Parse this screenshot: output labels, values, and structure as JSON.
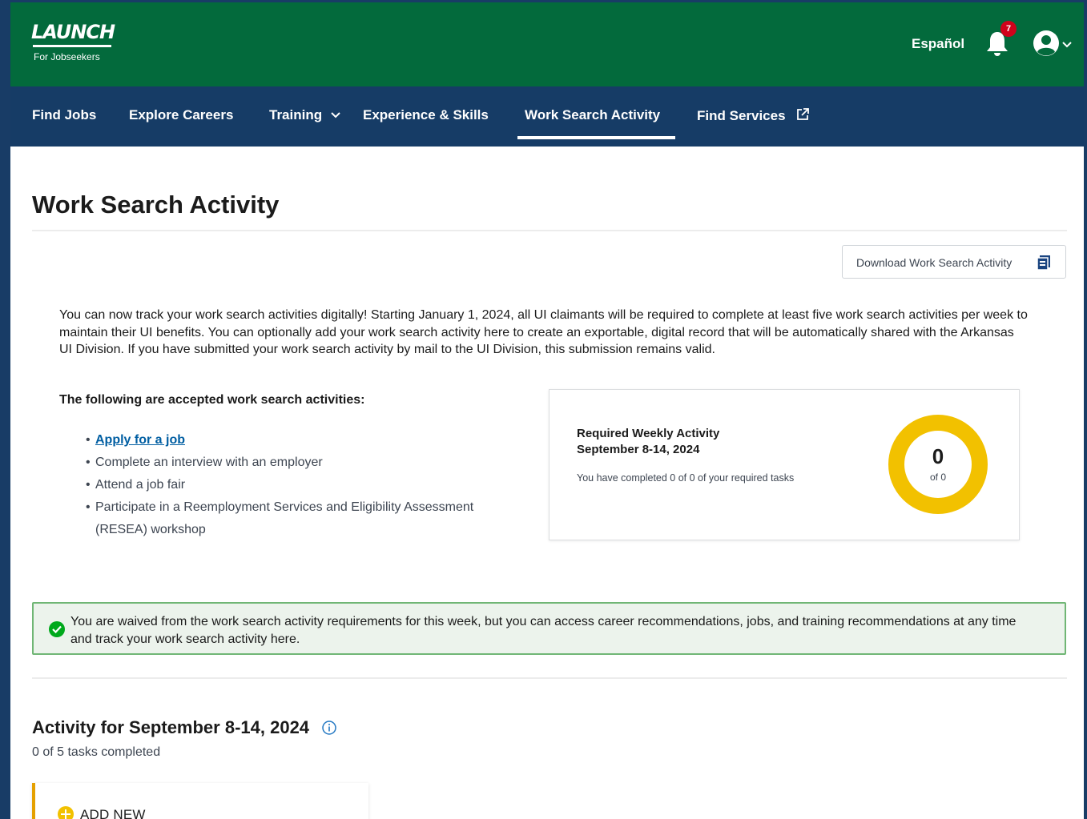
{
  "header": {
    "logo_text": "LAUNCH",
    "logo_subtitle": "For Jobseekers",
    "language_link": "Español",
    "notification_count": "7",
    "icons": {
      "bell": "bell-icon",
      "account": "account-circle-icon",
      "chevron": "chevron-down-icon"
    }
  },
  "nav": {
    "items": [
      {
        "label": "Find Jobs"
      },
      {
        "label": "Explore Careers"
      },
      {
        "label": "Training"
      },
      {
        "label": "Experience & Skills"
      },
      {
        "label": "Work Search Activity"
      },
      {
        "label": "Find Services"
      }
    ],
    "active": "Work Search Activity"
  },
  "page": {
    "title": "Work Search Activity",
    "download_label": "Download Work Search Activity",
    "intro": "You can now track your work search activities digitally! Starting January 1, 2024, all UI claimants will be required to complete at least five work search activities per week to maintain their UI benefits. You can optionally add your work search activity here to create an exportable, digital record that will be automatically shared with the Arkansas UI Division. If you have submitted your work search activity by mail to the UI Division, this submission remains valid.",
    "accepted_heading": "The following are accepted work search activities:",
    "activities": [
      "Apply for a job",
      "Complete an interview with an employer",
      "Attend a job fair",
      "Participate in a Reemployment Services and Eligibility Assessment",
      "(RESEA) workshop"
    ]
  },
  "weekly_card": {
    "title": "Required Weekly Activity",
    "date_range": "September 8-14, 2024",
    "completed_text": "You have completed 0 of 0 of your required tasks",
    "donut_value": "0",
    "donut_total": "of 0",
    "progress_fraction": 0,
    "accent_color": "#f2c100"
  },
  "alert": {
    "message": "You are waived from the work search activity requirements for this week, but you can access career recommendations, jobs, and training recommendations at any time and track your work search activity here.",
    "color": "#70b675"
  },
  "week_section": {
    "title": "Activity for September 8-14, 2024",
    "subtitle": "0 of 5 tasks completed",
    "add_new_label": "ADD NEW"
  },
  "colors": {
    "header_green": "#036a3c",
    "nav_blue": "#163c66",
    "link_blue": "#005ea2"
  }
}
